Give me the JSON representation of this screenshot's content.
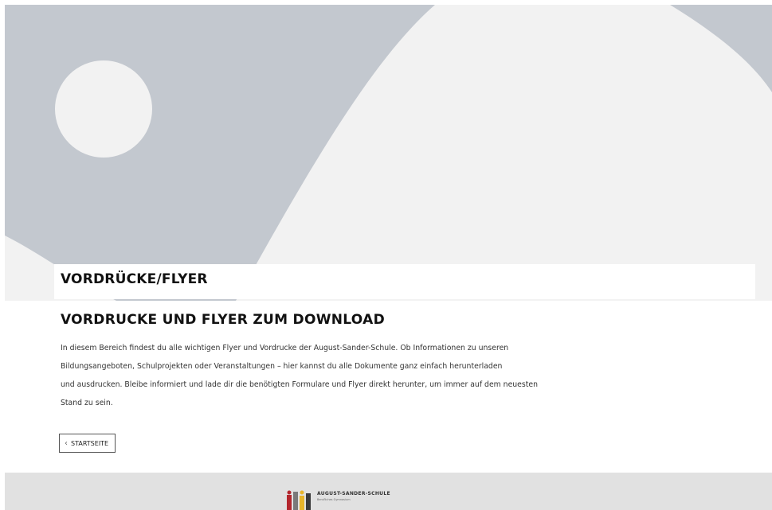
{
  "hero": {
    "title": "VORDRÜCKE/FLYER"
  },
  "content": {
    "heading": "VORDRUCKE UND FLYER ZUM DOWNLOAD",
    "paragraph_lines": [
      "In diesem Bereich findest du alle wichtigen Flyer und Vordrucke der August-Sander-Schule. Ob Informationen zu unseren",
      "Bildungsangeboten, Schulprojekten oder Veranstaltungen – hier kannst du alle Dokumente ganz einfach herunterladen",
      "und ausdrucken. Bleibe informiert und lade dir die benötigten Formulare und Flyer direkt herunter, um immer auf dem neuesten",
      "Stand zu sein."
    ]
  },
  "nav": {
    "back_label": "STARTSEITE",
    "back_icon": "chevron-left-icon"
  },
  "footer": {
    "logo_name": "AUGUST-SANDER-SCHULE",
    "logo_subline": "Berufliches Gymnasium"
  },
  "colors": {
    "hero_gray": "#c3c8cf",
    "hero_light": "#f2f2f2",
    "footer_gray": "#e1e1e1",
    "logo_red": "#b3262d",
    "logo_yellow": "#e8b52a"
  }
}
